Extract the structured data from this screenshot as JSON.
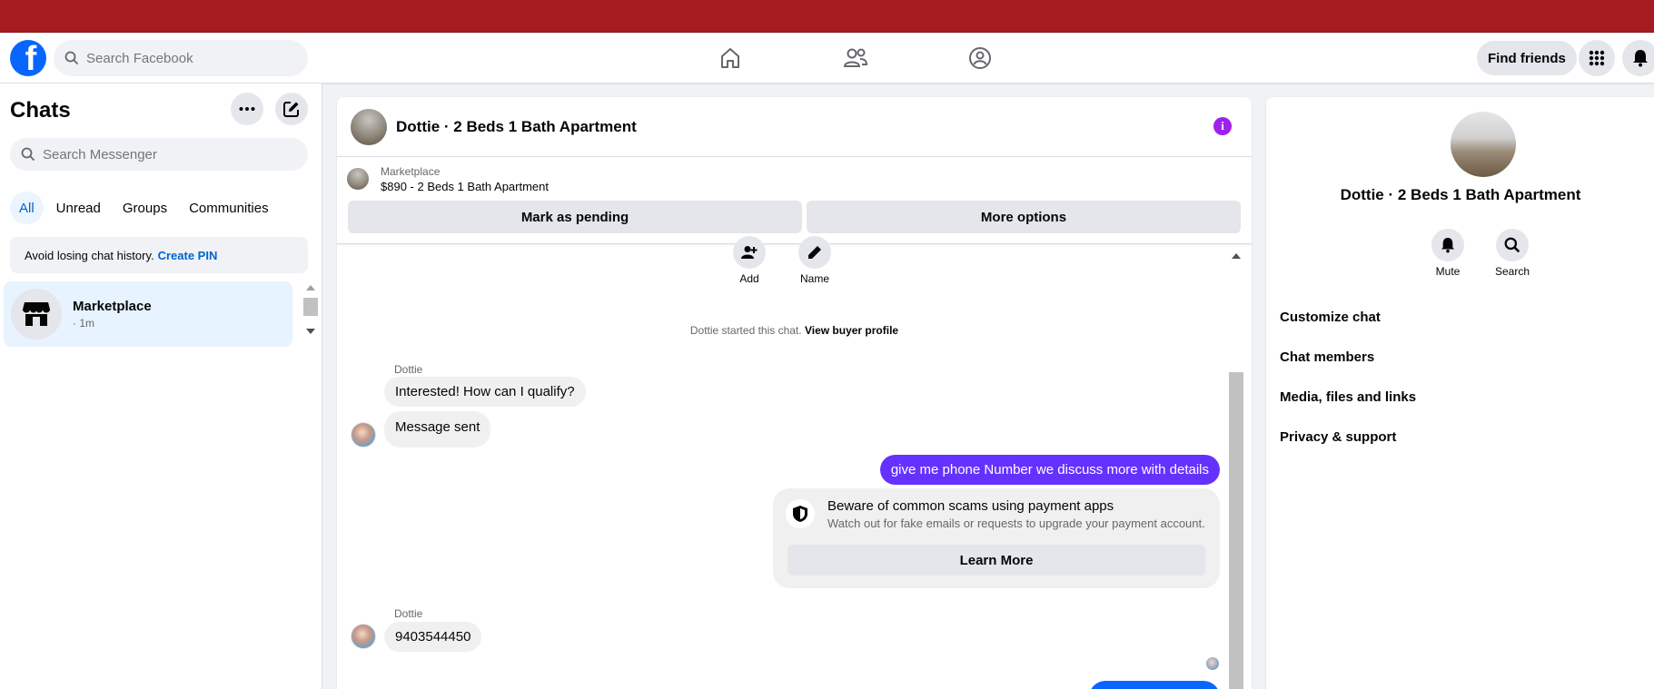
{
  "header": {
    "logo_letter": "f",
    "search_placeholder": "Search Facebook",
    "find_friends_label": "Find friends"
  },
  "sidebar": {
    "title": "Chats",
    "search_placeholder": "Search Messenger",
    "filters": [
      "All",
      "Unread",
      "Groups",
      "Communities"
    ],
    "active_filter": "All",
    "pin_notice": "Avoid losing chat history.",
    "pin_link": "Create PIN",
    "chats": [
      {
        "name": "Marketplace",
        "time": "· 1m"
      }
    ]
  },
  "conversation": {
    "title": "Dottie · 2 Beds 1 Bath Apartment",
    "marketplace_label": "Marketplace",
    "listing": "$890 - 2 Beds 1 Bath Apartment",
    "mark_pending_label": "Mark as pending",
    "more_options_label": "More options",
    "actions": {
      "add": "Add",
      "name": "Name"
    },
    "started_text": "Dottie started this chat.",
    "buyer_profile_link": "View buyer profile",
    "messages": {
      "sender1": "Dottie",
      "in1": "Interested! How can I qualify?",
      "in2": "Message sent",
      "out1": "give me phone Number we discuss more with details",
      "sender2": "Dottie",
      "in3": "9403544450"
    },
    "scam_card": {
      "title": "Beware of common scams using payment apps",
      "subtitle": "Watch out for fake emails or requests to upgrade your payment account.",
      "button": "Learn More"
    }
  },
  "details": {
    "title": "Dottie · 2 Beds 1 Bath Apartment",
    "mute_label": "Mute",
    "search_label": "Search",
    "menu": [
      "Customize chat",
      "Chat members",
      "Media, files and links",
      "Privacy & support"
    ]
  },
  "colors": {
    "brand": "#0866ff",
    "outgoing_bubble": "#6531ff",
    "info_icon": "#a020f0",
    "top_bar": "#a61b20"
  }
}
